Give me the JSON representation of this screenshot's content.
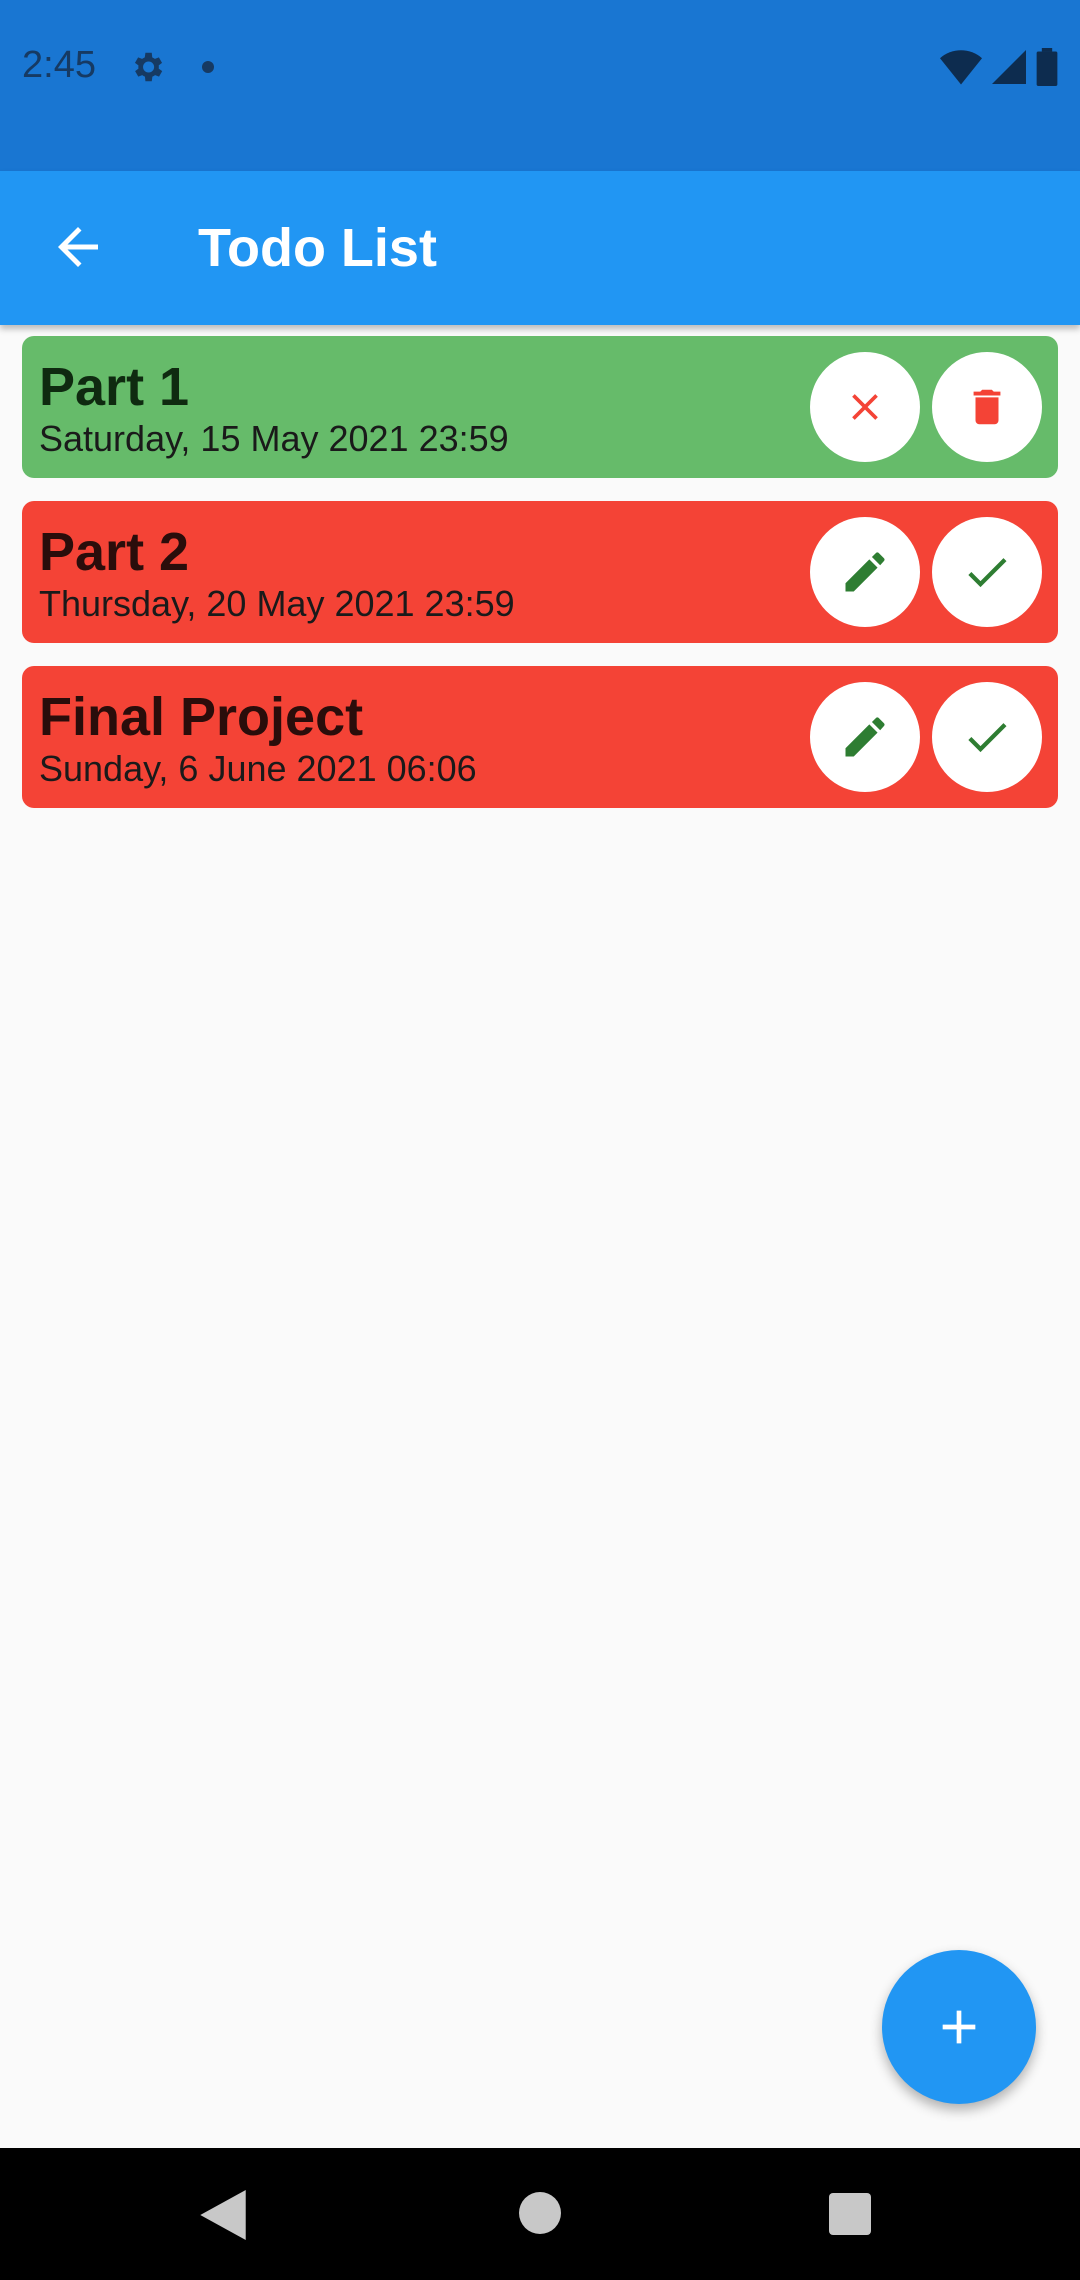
{
  "status_bar": {
    "time": "2:45"
  },
  "app_bar": {
    "title": "Todo List"
  },
  "todos": [
    {
      "title": "Part 1",
      "date": "Saturday, 15 May 2021 23:59",
      "state": "done"
    },
    {
      "title": "Part 2",
      "date": "Thursday, 20 May 2021 23:59",
      "state": "pending"
    },
    {
      "title": "Final Project",
      "date": "Sunday, 6 June 2021 06:06",
      "state": "pending"
    }
  ],
  "colors": {
    "status_bar": "#1976d2",
    "app_bar": "#2196f3",
    "done_card": "#66bb6a",
    "pending_card": "#f44336",
    "background": "#fafafa"
  },
  "icons": {
    "done_actions": [
      "close-icon",
      "trash-icon"
    ],
    "pending_actions": [
      "pencil-icon",
      "check-icon"
    ],
    "fab": "plus-icon"
  }
}
